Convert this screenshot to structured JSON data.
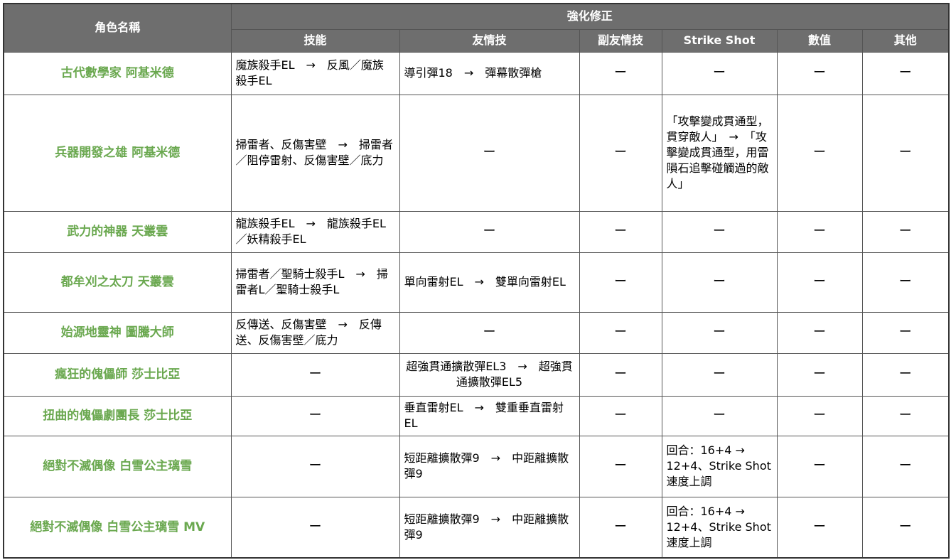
{
  "header": {
    "character_name": "角色名稱",
    "group": "強化修正",
    "columns": [
      "技能",
      "友情技",
      "副友情技",
      "Strike Shot",
      "數值",
      "其他"
    ]
  },
  "rows": [
    {
      "name": "古代數學家 阿基米德",
      "skill": "魔族殺手EL　→　反風／魔族殺手EL",
      "friend": "導引彈18　→　彈幕散彈槍",
      "sub_friend": "ー",
      "strike_shot": "ー",
      "value": "ー",
      "other": "ー"
    },
    {
      "name": "兵器開發之雄 阿基米德",
      "skill": "掃雷者、反傷害壁　→　掃雷者／阻停雷射、反傷害壁／底力",
      "friend": "ー",
      "sub_friend": "ー",
      "strike_shot": "「攻擊變成貫通型，貫穿敵人」　→　「攻擊變成貫通型，用雷隕石追擊碰觸過的敵人」",
      "value": "ー",
      "other": "ー"
    },
    {
      "name": "武力的神器 天叢雲",
      "skill": "龍族殺手EL　→　龍族殺手EL／妖精殺手EL",
      "friend": "ー",
      "sub_friend": "ー",
      "strike_shot": "ー",
      "value": "ー",
      "other": "ー"
    },
    {
      "name": "都牟刈之太刀 天叢雲",
      "skill": "掃雷者／聖騎士殺手L　→　掃雷者L／聖騎士殺手L",
      "friend": "單向雷射EL　→　雙單向雷射EL",
      "sub_friend": "ー",
      "strike_shot": "ー",
      "value": "ー",
      "other": "ー"
    },
    {
      "name": "始源地靈神 圖騰大師",
      "skill": "反傳送、反傷害壁　→　反傳送、反傷害壁／底力",
      "friend": "ー",
      "sub_friend": "ー",
      "strike_shot": "ー",
      "value": "ー",
      "other": "ー"
    },
    {
      "name": "瘋狂的傀儡師 莎士比亞",
      "skill": "ー",
      "friend": "超強貫通擴散彈EL3　→　超強貫通擴散彈EL5",
      "sub_friend": "ー",
      "strike_shot": "ー",
      "value": "ー",
      "other": "ー"
    },
    {
      "name": "扭曲的傀儡劇團長 莎士比亞",
      "skill": "ー",
      "friend": "垂直雷射EL　→　雙重垂直雷射EL",
      "sub_friend": "ー",
      "strike_shot": "ー",
      "value": "ー",
      "other": "ー"
    },
    {
      "name": "絕對不滅偶像 白雪公主璃雪",
      "skill": "ー",
      "friend": "短距離擴散彈9　→　中距離擴散彈9",
      "sub_friend": "ー",
      "strike_shot": "回合：16+4 → 12+4、Strike Shot速度上調",
      "value": "ー",
      "other": "ー"
    },
    {
      "name": "絕對不滅偶像 白雪公主璃雪 MV",
      "skill": "ー",
      "friend": "短距離擴散彈9　→　中距離擴散彈9",
      "sub_friend": "ー",
      "strike_shot": "回合：16+4 → 12+4、Strike Shot速度上調",
      "value": "ー",
      "other": "ー"
    }
  ],
  "colors": {
    "header_bg": "#6e6e6e",
    "header_text": "#ffffff",
    "name_text": "#6aa84f",
    "border": "#555555"
  }
}
